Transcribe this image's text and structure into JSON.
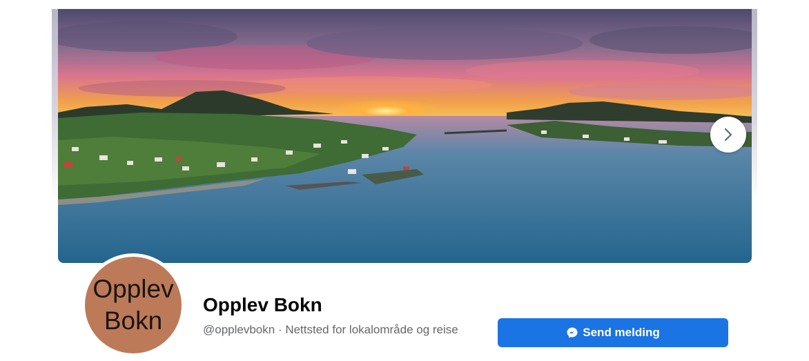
{
  "cover": {
    "image": "aerial-sunset-coastal-village-photo",
    "colors": {
      "sky_top": "#4d4a6e",
      "sunset": "#f29a3a",
      "pink_clouds": "#e86a8a",
      "water": "#2f6f94"
    }
  },
  "avatar": {
    "line1": "Opplev",
    "line2": "Bokn",
    "bg": "#bc7a59"
  },
  "profile": {
    "name": "Opplev Bokn",
    "subtitle": "@opplevbokn · Nettsted for lokalområde og reise"
  },
  "actions": {
    "send_message_label": "Send melding",
    "accent": "#1b74e4"
  },
  "icons": {
    "next": "chevron-right-icon",
    "messenger": "messenger-icon"
  }
}
